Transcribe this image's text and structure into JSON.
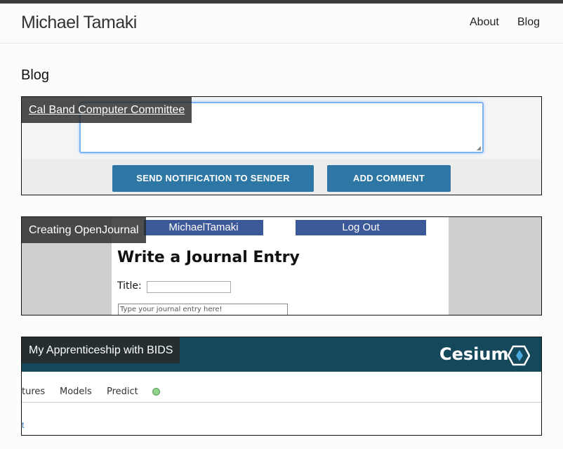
{
  "header": {
    "site_title": "Michael Tamaki",
    "nav": [
      {
        "label": "About"
      },
      {
        "label": "Blog"
      }
    ]
  },
  "page": {
    "heading": "Blog"
  },
  "posts": [
    {
      "title": "Cal Band Computer Committee",
      "preview": {
        "buttons": [
          "SEND NOTIFICATION TO SENDER",
          "ADD COMMENT"
        ]
      }
    },
    {
      "title": "Creating OpenJournal",
      "preview": {
        "nav": [
          "MichaelTamaki",
          "Log Out"
        ],
        "heading": "Write a Journal Entry",
        "title_label": "Title:",
        "entry_placeholder": "Type your journal entry here!"
      }
    },
    {
      "title": "My Apprenticeship with BIDS",
      "preview": {
        "logo": "Cesium",
        "nav": [
          "tures",
          "Models",
          "Predict"
        ],
        "link_fragment": "t",
        "status_color": "#8fd18a"
      }
    }
  ],
  "colors": {
    "topbar": "#3b3b3b",
    "button_blue": "#2e76a4",
    "journal_nav_blue": "#3b5998",
    "cesium_banner": "#16485c"
  }
}
